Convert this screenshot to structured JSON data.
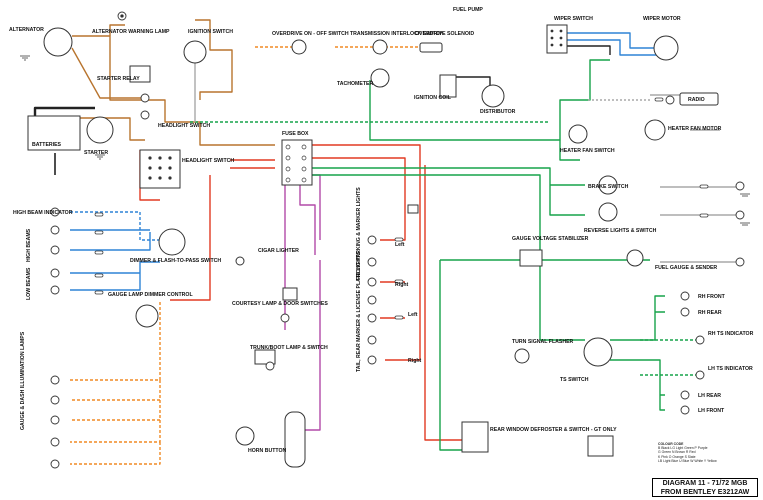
{
  "labels": {
    "fuel_pump": "FUEL PUMP",
    "alternator": "ALTERNATOR",
    "alt_warning_lamp": "ALTERNATOR WARNING LAMP",
    "ignition_switch": "IGNITION SWITCH",
    "overdrive_switch": "OVERDRIVE ON - OFF SWITCH",
    "trans_interlock": "TRANSMISSION INTERLOCK SWITCH",
    "overdrive_solenoid": "OVERDRIVE SOLENOID",
    "wiper_switch": "WIPER SWITCH",
    "wiper_motor": "WIPER MOTOR",
    "starter_relay": "STARTER RELAY",
    "tachometer": "TACHOMETER",
    "ignition_coil": "IGNITION COIL",
    "distributor": "DISTRIBUTOR",
    "radio": "RADIO",
    "battery": "BATTERIES",
    "starter": "STARTER",
    "headlight_switch_top": "HEADLIGHT SWITCH",
    "fuse_box": "FUSE BOX",
    "headlight_switch": "HEADLIGHT SWITCH",
    "heater_fan_switch": "HEATER FAN SWITCH",
    "heater_fan_motor": "HEATER FAN MOTOR",
    "brake_switch": "BRAKE SWITCH",
    "high_beam_indicator": "HIGH BEAM INDICATOR",
    "high_beams": "HIGH BEAMS",
    "low_beams": "LOW BEAMS",
    "dimmer_switch": "DIMMER & FLASH-TO-PASS SWITCH",
    "cigar_lighter": "CIGAR LIGHTER",
    "front_parking": "FRONT PARKING & MARKER LIGHTS",
    "reverse_lights": "REVERSE LIGHTS & SWITCH",
    "gauge_voltage": "GAUGE VOLTAGE STABILIZER",
    "fuel_gauge": "FUEL GAUGE & SENDER",
    "gauge_lamp_dimmer": "GAUGE LAMP DIMMER CONTROL",
    "courtesy_lamp": "COURTESY LAMP & DOOR SWITCHES",
    "rh_front": "RH FRONT",
    "rh_rear": "RH REAR",
    "rh_ts_indicator": "RH TS INDICATOR",
    "turn_signal_flasher": "TURN SIGNAL FLASHER",
    "tail_lights": "TAIL, REAR MARKER & LICENSE PLATE LIGHTS",
    "trunk_lamp": "TRUNK/BOOT LAMP & SWITCH",
    "ts_switch": "TS SWITCH",
    "lh_ts_indicator": "LH TS INDICATOR",
    "lh_rear": "LH REAR",
    "lh_front": "LH FRONT",
    "gauge_dash_lamps": "GAUGE & DASH ILLUMINATION LAMPS",
    "horn_button": "HORN BUTTON",
    "rear_defroster": "REAR WINDOW DEFROSTER & SWITCH - GT ONLY",
    "left": "Left",
    "right": "Right"
  },
  "title": {
    "line1": "DIAGRAM 11 - 71/72 MGB",
    "line2": "FROM BENTLEY E3212AW"
  },
  "key_header": "COLOUR CODE",
  "key_rows": [
    "B  Black    LG  Light Green    P  Purple",
    "G  Green    N   Brown          R  Red",
    "K  Pink     O   Orange         S  Slate",
    "LB Light Blue  U  Blue         W  White  Y  Yellow"
  ],
  "wire_colors": {
    "brown": "#b8742e",
    "red": "#e23a22",
    "green": "#17a34a",
    "purple": "#b24aa8",
    "blue": "#2f84d6",
    "black": "#222222",
    "orange": "#f08a24",
    "white": "#a8a8a8",
    "slate": "#7a8a9a"
  }
}
